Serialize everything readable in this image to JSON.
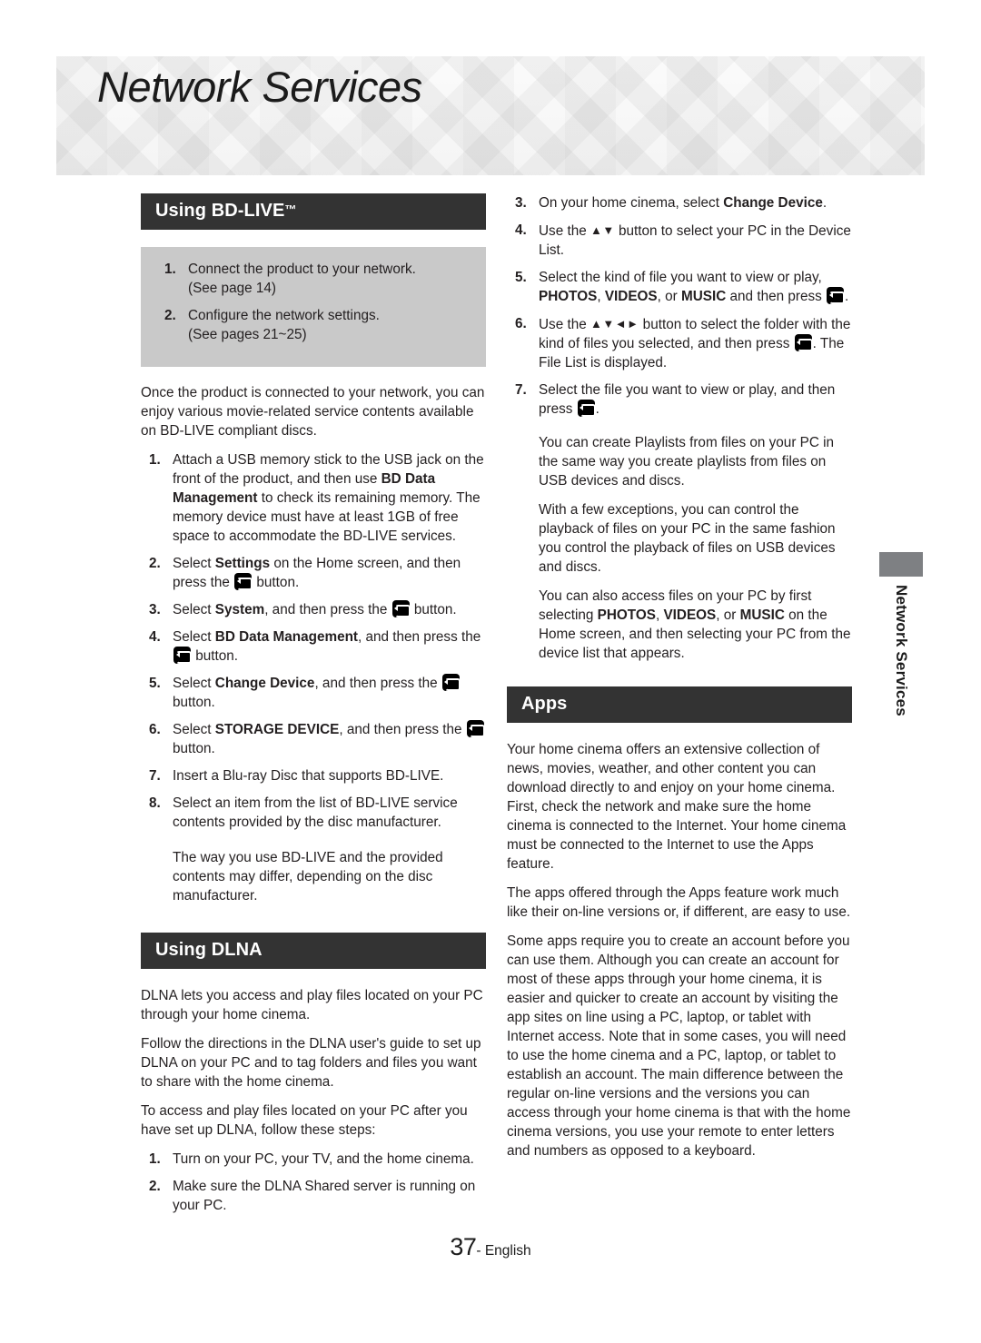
{
  "banner": {
    "title": "Network Services"
  },
  "side_tab": {
    "label": "Network Services"
  },
  "footer": {
    "page_number": "37",
    "language": "- English"
  },
  "colors": {
    "section_bar_bg": "#333333",
    "section_bar_text": "#ffffff",
    "grey_box_bg": "#c9c9c9",
    "side_tab_swatch": "#7e8083",
    "body_text": "#231f20",
    "page_bg": "#ffffff"
  },
  "icons": {
    "enter_button": "enter-button-icon",
    "up_down": "▲▼",
    "up_down_left_right": "▲▼◄►"
  },
  "left_column": {
    "section_bdlive": {
      "heading": "Using BD-LIVE",
      "heading_tm": "™",
      "grey_box_steps": [
        {
          "num": "1.",
          "line1": "Connect the product to your network.",
          "line2": "(See page 14)"
        },
        {
          "num": "2.",
          "line1": "Configure the network settings.",
          "line2": "(See pages 21~25)"
        }
      ],
      "intro": "Once the product is connected to your network, you can enjoy various movie-related service contents available on BD-LIVE compliant discs.",
      "steps": [
        {
          "num": "1.",
          "text_pre": "Attach a USB memory stick to the USB jack on the front of the product, and then use ",
          "bold1": "BD Data Management",
          "text_mid": " to check its remaining memory. The memory device must have at least 1GB of free space to accommodate the BD-LIVE services."
        },
        {
          "num": "2.",
          "text_pre": "Select ",
          "bold1": "Settings",
          "text_mid": " on the Home screen, and then press the ",
          "has_icon": true,
          "text_post": " button."
        },
        {
          "num": "3.",
          "text_pre": "Select ",
          "bold1": "System",
          "text_mid": ", and then press the ",
          "has_icon": true,
          "text_post": " button."
        },
        {
          "num": "4.",
          "text_pre": "Select ",
          "bold1": "BD Data Management",
          "text_mid": ", and then press the ",
          "has_icon": true,
          "text_post": " button."
        },
        {
          "num": "5.",
          "text_pre": "Select ",
          "bold1": "Change Device",
          "text_mid": ", and then press the ",
          "has_icon": true,
          "text_post": " button."
        },
        {
          "num": "6.",
          "text_pre": "Select ",
          "bold1": "STORAGE DEVICE",
          "text_mid": ", and then press the ",
          "has_icon": true,
          "text_post": " button."
        },
        {
          "num": "7.",
          "text_pre": "Insert a Blu-ray Disc that supports BD-LIVE."
        },
        {
          "num": "8.",
          "text_pre": "Select an item from the list of BD-LIVE service contents provided by the disc manufacturer."
        }
      ],
      "closing_note": "The way you use BD-LIVE and the provided contents may differ, depending on the disc manufacturer."
    },
    "section_dlna": {
      "heading": "Using DLNA",
      "paragraphs": [
        "DLNA lets you access and play files located on your PC through your home cinema.",
        "Follow the directions in the DLNA user's guide to set up DLNA on your PC and to tag folders and files you want to share with the home cinema.",
        "To access and play files located on your PC after you have set up DLNA, follow these steps:"
      ],
      "steps": [
        {
          "num": "1.",
          "text_pre": "Turn on your PC, your TV, and the home cinema."
        },
        {
          "num": "2.",
          "text_pre": "Make sure the DLNA Shared server is running on your PC."
        }
      ]
    }
  },
  "right_column": {
    "dlna_steps_continued": [
      {
        "num": "3.",
        "text_pre": "On your home cinema, select ",
        "bold1": "Change Device",
        "text_mid": "."
      },
      {
        "num": "4.",
        "text_pre": "Use the ",
        "arrows": "▲▼",
        "text_mid": " button to select your PC in the Device List."
      },
      {
        "num": "5.",
        "text_pre": "Select the kind of file you want to view or play, ",
        "bold1": "PHOTOS",
        "sep1": ", ",
        "bold2": "VIDEOS",
        "sep2": ", or ",
        "bold3": "MUSIC",
        "text_mid": " and then press ",
        "has_icon": true,
        "text_post": "."
      },
      {
        "num": "6.",
        "text_pre": "Use the ",
        "arrows": "▲▼◄►",
        "text_mid": " button to select the folder with the kind of files you selected, and then press ",
        "has_icon": true,
        "text_post": ". The File List is displayed."
      },
      {
        "num": "7.",
        "text_pre": "Select the file you want to view or play, and then press ",
        "has_icon": true,
        "text_post": "."
      }
    ],
    "dlna_notes": [
      "You can create Playlists from files on your PC in the same way you create playlists from files on USB devices and discs.",
      "With a few exceptions, you can control the playback of files on your PC in the same fashion you control the playback of files on USB devices and discs."
    ],
    "dlna_note_rich": {
      "pre": "You can also access files on your PC by first selecting ",
      "bold1": "PHOTOS",
      "sep1": ", ",
      "bold2": "VIDEOS",
      "sep2": ", or ",
      "bold3": "MUSIC",
      "post": " on the Home screen, and then selecting your PC from the device list that appears."
    },
    "section_apps": {
      "heading": "Apps",
      "paragraphs": [
        "Your home cinema offers an extensive collection of news, movies, weather, and other content you can download directly to and enjoy on your home cinema. First, check the network and make sure the home cinema is connected to the Internet. Your home cinema must be connected to the Internet to use the Apps feature.",
        "The apps offered through the Apps feature work much like their on-line versions or, if different, are easy to use.",
        "Some apps require you to create an account before you can use them. Although you can create an account for most of these apps through your home cinema, it is easier and quicker to create an account by visiting the app sites on line using a PC, laptop, or tablet with Internet access. Note that in some cases, you will need to use the home cinema and a PC, laptop, or tablet to establish an account. The main difference between the regular on-line versions and the versions you can access through your home cinema is that with the home cinema versions, you use your remote to enter letters and numbers as opposed to a keyboard."
      ]
    }
  }
}
